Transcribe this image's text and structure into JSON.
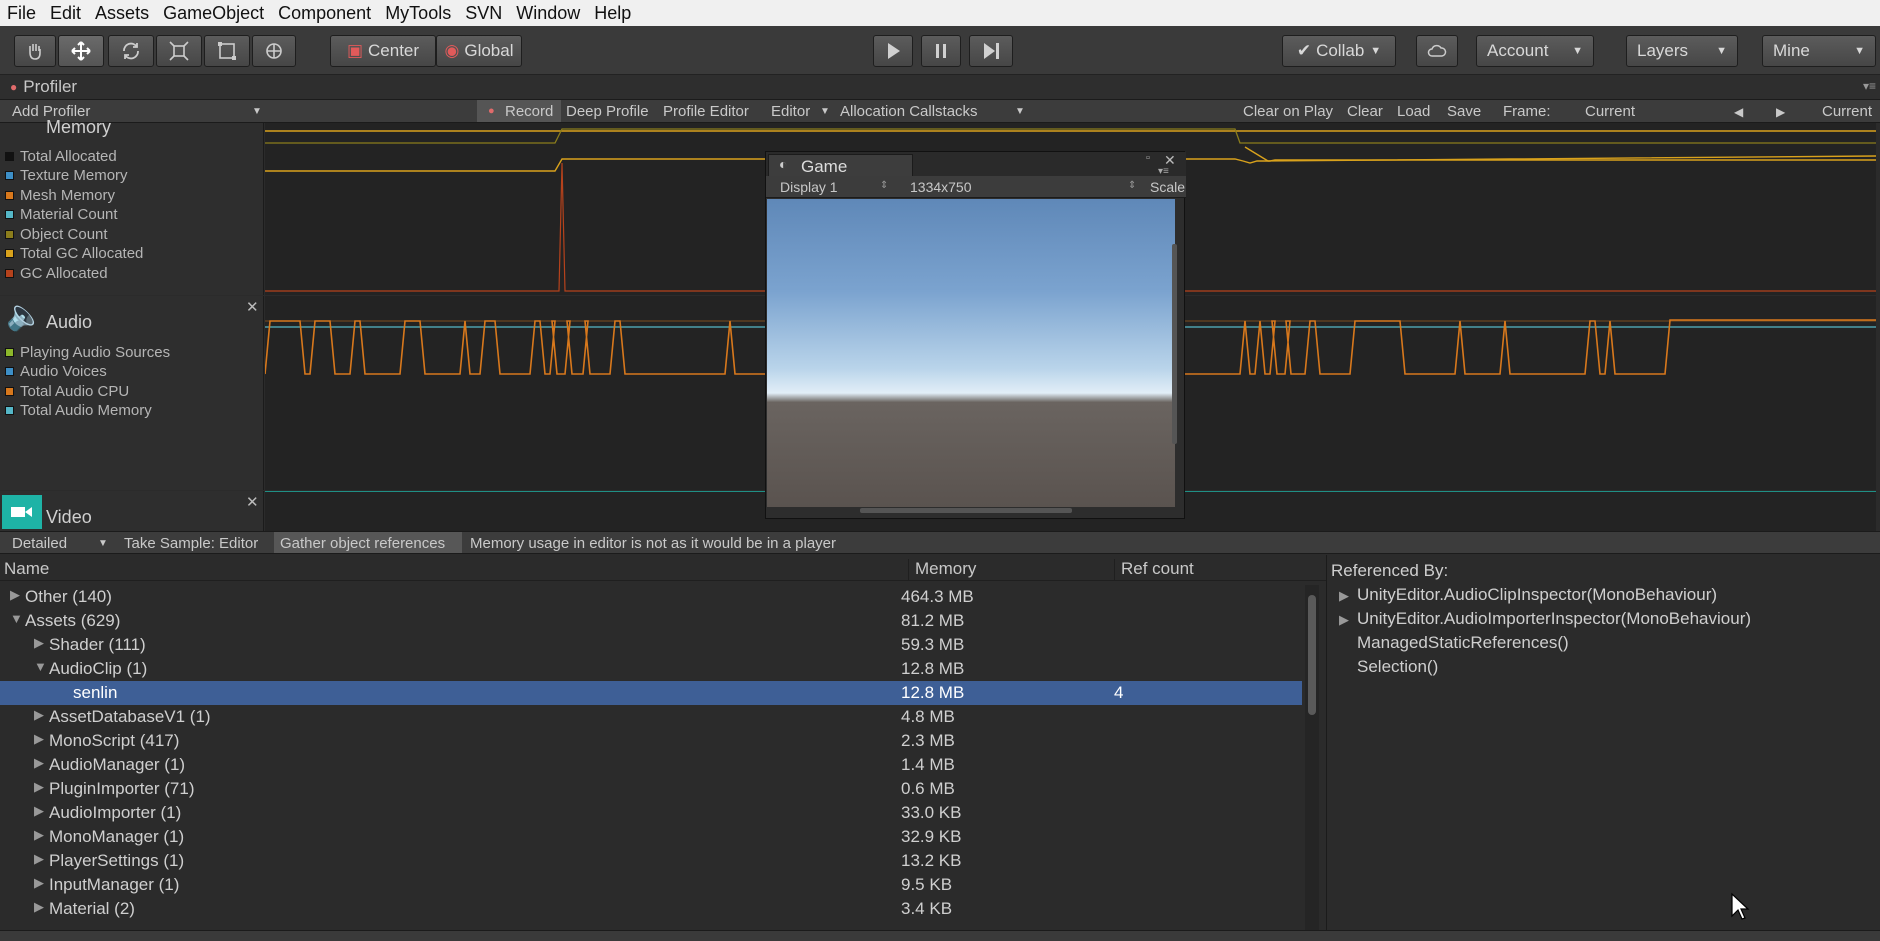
{
  "menu": [
    "File",
    "Edit",
    "Assets",
    "GameObject",
    "Component",
    "MyTools",
    "SVN",
    "Window",
    "Help"
  ],
  "toolbar": {
    "pivot": "Center",
    "space": "Global",
    "collab": "Collab",
    "account": "Account",
    "layers": "Layers",
    "layout": "Mine"
  },
  "profiler": {
    "tab_title": "Profiler",
    "add_profiler": "Add Profiler",
    "record": "Record",
    "deep_profile": "Deep Profile",
    "profile_editor": "Profile Editor",
    "target": "Editor",
    "allocation_callstacks": "Allocation Callstacks",
    "clear_on_play": "Clear on Play",
    "clear": "Clear",
    "load": "Load",
    "save": "Save",
    "frame_label": "Frame:",
    "frame_value": "Current",
    "current": "Current"
  },
  "modules": {
    "memory": {
      "title": "Memory",
      "items": [
        {
          "label": "Total Allocated",
          "color": "#111111"
        },
        {
          "label": "Texture Memory",
          "color": "#3d8fc7"
        },
        {
          "label": "Mesh Memory",
          "color": "#d8781c"
        },
        {
          "label": "Material Count",
          "color": "#55b7c7"
        },
        {
          "label": "Object Count",
          "color": "#8b7d1c"
        },
        {
          "label": "Total GC Allocated",
          "color": "#d9a21c"
        },
        {
          "label": "GC Allocated",
          "color": "#b5421c"
        }
      ]
    },
    "audio": {
      "title": "Audio",
      "items": [
        {
          "label": "Playing Audio Sources",
          "color": "#8db82b"
        },
        {
          "label": "Audio Voices",
          "color": "#3d8fc7"
        },
        {
          "label": "Total Audio CPU",
          "color": "#d8781c"
        },
        {
          "label": "Total Audio Memory",
          "color": "#55b7c7"
        }
      ]
    },
    "video": {
      "title": "Video"
    }
  },
  "game": {
    "title": "Game",
    "display": "Display 1",
    "resolution": "1334x750",
    "scale": "Scale"
  },
  "detail": {
    "mode": "Detailed",
    "take_sample": "Take Sample: Editor",
    "gather": "Gather object references",
    "note": "Memory usage in editor is not as it would be in a player"
  },
  "tree": {
    "headers": {
      "name": "Name",
      "memory": "Memory",
      "refcount": "Ref count"
    },
    "rows": [
      {
        "name": "Other (140)",
        "memory": "464.3 MB",
        "ref": "",
        "indent": 0,
        "arrow": "▶"
      },
      {
        "name": "Assets (629)",
        "memory": "81.2 MB",
        "ref": "",
        "indent": 0,
        "arrow": "▼"
      },
      {
        "name": "Shader (111)",
        "memory": "59.3 MB",
        "ref": "",
        "indent": 1,
        "arrow": "▶"
      },
      {
        "name": "AudioClip (1)",
        "memory": "12.8 MB",
        "ref": "",
        "indent": 1,
        "arrow": "▼"
      },
      {
        "name": "senlin",
        "memory": "12.8 MB",
        "ref": "4",
        "indent": 2,
        "arrow": "",
        "selected": true
      },
      {
        "name": "AssetDatabaseV1 (1)",
        "memory": "4.8 MB",
        "ref": "",
        "indent": 1,
        "arrow": "▶"
      },
      {
        "name": "MonoScript (417)",
        "memory": "2.3 MB",
        "ref": "",
        "indent": 1,
        "arrow": "▶"
      },
      {
        "name": "AudioManager (1)",
        "memory": "1.4 MB",
        "ref": "",
        "indent": 1,
        "arrow": "▶"
      },
      {
        "name": "PluginImporter (71)",
        "memory": "0.6 MB",
        "ref": "",
        "indent": 1,
        "arrow": "▶"
      },
      {
        "name": "AudioImporter (1)",
        "memory": "33.0 KB",
        "ref": "",
        "indent": 1,
        "arrow": "▶"
      },
      {
        "name": "MonoManager (1)",
        "memory": "32.9 KB",
        "ref": "",
        "indent": 1,
        "arrow": "▶"
      },
      {
        "name": "PlayerSettings (1)",
        "memory": "13.2 KB",
        "ref": "",
        "indent": 1,
        "arrow": "▶"
      },
      {
        "name": "InputManager (1)",
        "memory": "9.5 KB",
        "ref": "",
        "indent": 1,
        "arrow": "▶"
      },
      {
        "name": "Material (2)",
        "memory": "3.4 KB",
        "ref": "",
        "indent": 1,
        "arrow": "▶"
      }
    ]
  },
  "referenced_by": {
    "title": "Referenced By:",
    "items": [
      {
        "label": "UnityEditor.AudioClipInspector(MonoBehaviour)",
        "arrow": "▶"
      },
      {
        "label": "UnityEditor.AudioImporterInspector(MonoBehaviour)",
        "arrow": "▶"
      },
      {
        "label": "ManagedStaticReferences()",
        "arrow": ""
      },
      {
        "label": "Selection()",
        "arrow": ""
      }
    ]
  }
}
